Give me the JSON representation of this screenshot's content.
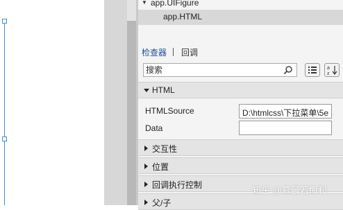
{
  "tree": {
    "items": [
      {
        "label": "app.UIFigure",
        "expanded": true
      },
      {
        "label": "app.HTML",
        "selected": true
      }
    ]
  },
  "inspector": {
    "tabs": [
      {
        "label": "检查器",
        "active": true
      },
      {
        "label": "回调",
        "active": false
      }
    ],
    "search": {
      "placeholder": "搜索"
    },
    "toolbar": [
      {
        "icon": "list-view-icon"
      },
      {
        "icon": "sort-az-icon"
      }
    ],
    "sections": {
      "html": {
        "label": "HTML",
        "expanded": true,
        "properties": [
          {
            "label": "HTMLSource",
            "value": "D:\\htmlcss\\下拉菜单\\5e"
          },
          {
            "label": "Data",
            "value": ""
          }
        ]
      },
      "interactivity": {
        "label": "交互性",
        "expanded": false
      },
      "position": {
        "label": "位置",
        "expanded": false
      },
      "callback_control": {
        "label": "回调执行控制",
        "expanded": false
      },
      "parent_child": {
        "label": "父/子",
        "expanded": false
      }
    }
  },
  "watermark": {
    "text": "知乎 @慕晨若悔利"
  },
  "colors": {
    "selection": "#3d8fd1",
    "active_tab": "#1f4e9a",
    "panel_bg": "#f4f4f4",
    "section_bg": "#e4e4e4",
    "selected_row": "#d8d8d8"
  }
}
